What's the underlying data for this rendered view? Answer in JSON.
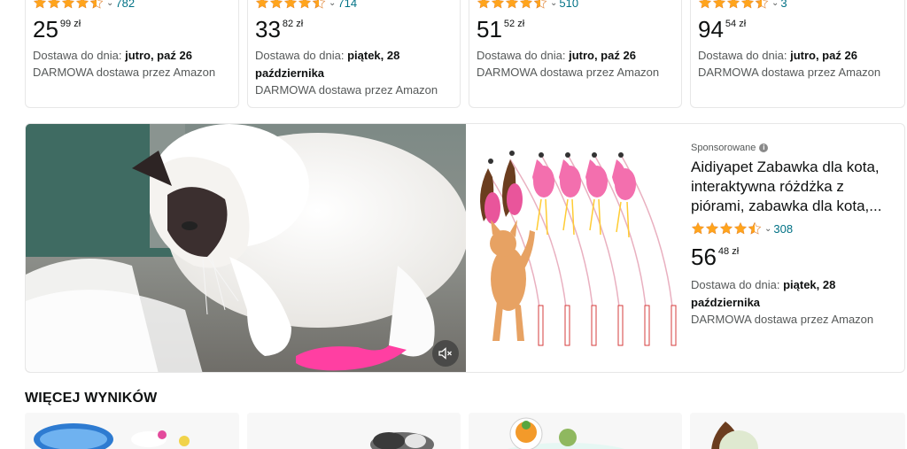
{
  "products_top": [
    {
      "rating": 4.5,
      "review_count": "782",
      "price_whole": "25",
      "price_frac": "99 zł",
      "delivery_prefix": "Dostawa do dnia:",
      "delivery_date": "jutro, paź 26",
      "free_shipping": "DARMOWA dostawa przez Amazon"
    },
    {
      "rating": 4.5,
      "review_count": "714",
      "price_whole": "33",
      "price_frac": "82 zł",
      "delivery_prefix": "Dostawa do dnia:",
      "delivery_date": "piątek, 28 października",
      "free_shipping": "DARMOWA dostawa przez Amazon"
    },
    {
      "rating": 4.5,
      "review_count": "510",
      "price_whole": "51",
      "price_frac": "52 zł",
      "delivery_prefix": "Dostawa do dnia:",
      "delivery_date": "jutro, paź 26",
      "free_shipping": "DARMOWA dostawa przez Amazon"
    },
    {
      "rating": 4.5,
      "review_count": "3",
      "price_whole": "94",
      "price_frac": "54 zł",
      "delivery_prefix": "Dostawa do dnia:",
      "delivery_date": "jutro, paź 26",
      "free_shipping": "DARMOWA dostawa przez Amazon"
    }
  ],
  "sponsored": {
    "label": "Sponsorowane",
    "info_icon": "info-icon",
    "title": "Aidiyapet Zabawka dla kota, interaktywna różdżka z piórami, zabawka dla kota,...",
    "rating": 4.5,
    "review_count": "308",
    "price_whole": "56",
    "price_frac": "48 zł",
    "delivery_prefix": "Dostawa do dnia:",
    "delivery_date": "piątek, 28 października",
    "free_shipping": "DARMOWA dostawa przez Amazon",
    "mute_icon": "speaker-muted-icon"
  },
  "more_results": {
    "heading": "WIĘCEJ WYNIKÓW"
  },
  "colors": {
    "star": "#ffa41c",
    "link": "#007185",
    "text": "#0f1111",
    "muted": "#565959"
  }
}
